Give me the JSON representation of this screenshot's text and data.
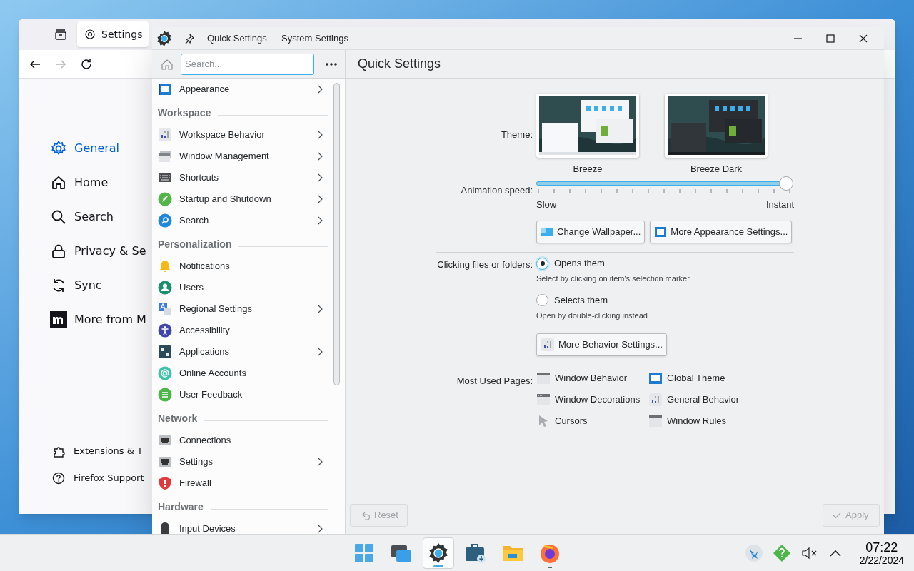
{
  "browser_window": {
    "tab": {
      "label": "Settings"
    },
    "nav": [
      {
        "disabled": false
      },
      {
        "disabled": true
      },
      {
        "disabled": false
      }
    ],
    "sidebar": {
      "items": [
        {
          "label": "General",
          "selected": true
        },
        {
          "label": "Home",
          "selected": false
        },
        {
          "label": "Search",
          "selected": false
        },
        {
          "label": "Privacy & Se",
          "selected": false
        },
        {
          "label": "Sync",
          "selected": false
        },
        {
          "label": "More from M",
          "selected": false
        }
      ],
      "footer_items": [
        {
          "label": "Extensions & T"
        },
        {
          "label": "Firefox Support"
        }
      ]
    }
  },
  "settings_window": {
    "title": "Quick Settings — System Settings",
    "search": {
      "placeholder": "Search..."
    },
    "sidebar": {
      "groups": [
        {
          "items": [
            {
              "label": "Appearance",
              "has_submenu": true
            }
          ]
        },
        {
          "heading": "Workspace",
          "items": [
            {
              "label": "Workspace Behavior",
              "has_submenu": true
            },
            {
              "label": "Window Management",
              "has_submenu": true
            },
            {
              "label": "Shortcuts",
              "has_submenu": true
            },
            {
              "label": "Startup and Shutdown",
              "has_submenu": true
            },
            {
              "label": "Search",
              "has_submenu": true
            }
          ]
        },
        {
          "heading": "Personalization",
          "items": [
            {
              "label": "Notifications",
              "has_submenu": false
            },
            {
              "label": "Users",
              "has_submenu": false
            },
            {
              "label": "Regional Settings",
              "has_submenu": true
            },
            {
              "label": "Accessibility",
              "has_submenu": false
            },
            {
              "label": "Applications",
              "has_submenu": true
            },
            {
              "label": "Online Accounts",
              "has_submenu": false
            },
            {
              "label": "User Feedback",
              "has_submenu": false
            }
          ]
        },
        {
          "heading": "Network",
          "items": [
            {
              "label": "Connections",
              "has_submenu": false
            },
            {
              "label": "Settings",
              "has_submenu": true
            },
            {
              "label": "Firewall",
              "has_submenu": false
            }
          ]
        },
        {
          "heading": "Hardware",
          "items": [
            {
              "label": "Input Devices",
              "has_submenu": true
            }
          ]
        }
      ]
    },
    "page": {
      "title": "Quick Settings",
      "theme": {
        "label": "Theme:",
        "options": [
          {
            "name": "Breeze",
            "kind": "light"
          },
          {
            "name": "Breeze Dark",
            "kind": "dark"
          }
        ]
      },
      "animation_speed": {
        "label": "Animation speed:",
        "level": 1,
        "min_label": "Slow",
        "max_label": "Instant"
      },
      "appearance_buttons": [
        {
          "label": "Change Wallpaper..."
        },
        {
          "label": "More Appearance Settings..."
        }
      ],
      "clicking": {
        "label": "Clicking files or folders:",
        "options": [
          {
            "label": "Opens them",
            "description": "Select by clicking on item's selection marker",
            "selected": true
          },
          {
            "label": "Selects them",
            "description": "Open by double-clicking instead",
            "selected": false
          }
        ]
      },
      "behavior_button": {
        "label": "More Behavior Settings..."
      },
      "most_used": {
        "label": "Most Used Pages:",
        "items": [
          {
            "label": "Window Behavior"
          },
          {
            "label": "Global Theme"
          },
          {
            "label": "Window Decorations"
          },
          {
            "label": "General Behavior"
          },
          {
            "label": "Cursors"
          },
          {
            "label": "Window Rules"
          }
        ]
      },
      "footer": {
        "reset": {
          "label": "Reset",
          "disabled": true
        },
        "apply": {
          "label": "Apply",
          "disabled": true
        }
      }
    }
  },
  "taskbar": {
    "apps": [
      {
        "active": false,
        "running": false
      },
      {
        "active": false,
        "running": false
      },
      {
        "active": true,
        "running": true
      },
      {
        "active": false,
        "running": false
      },
      {
        "active": false,
        "running": false
      },
      {
        "active": false,
        "running": true
      }
    ],
    "clock": {
      "time": "07:22",
      "date": "2/22/2024"
    }
  }
}
